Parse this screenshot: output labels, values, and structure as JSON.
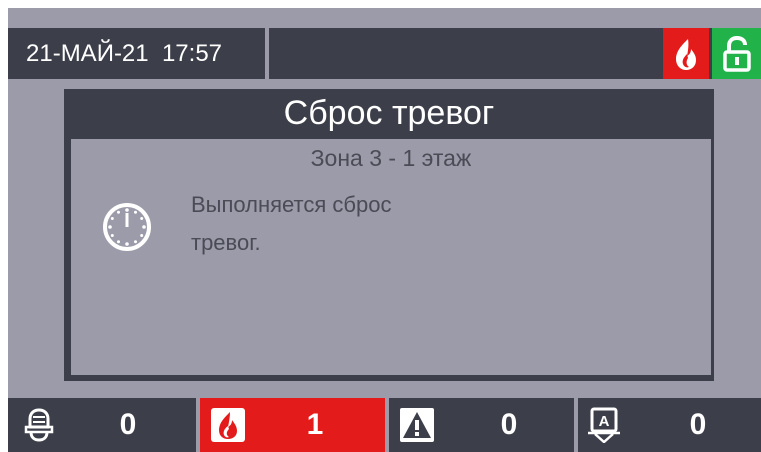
{
  "status_bar": {
    "datetime": "21-МАЙ-21  17:57",
    "icons": [
      "fire-icon",
      "unlocked-padlock-icon"
    ],
    "colors": {
      "fire": "#e41b1b",
      "unlocked": "#21b24a"
    }
  },
  "dialog": {
    "title": "Сброс тревог",
    "zone": "Зона 3 - 1 этаж",
    "message_line1": "Выполняется сброс",
    "message_line2": "тревог.",
    "icon": "clock-icon"
  },
  "counters": [
    {
      "icon": "siren-icon",
      "value": "0"
    },
    {
      "icon": "fire-icon",
      "value": "1",
      "active": true
    },
    {
      "icon": "warning-triangle-icon",
      "value": "0"
    },
    {
      "icon": "disabled-alarm-icon",
      "value": "0"
    }
  ],
  "colors": {
    "background": "#9b9baa",
    "panel": "#3c3f4a",
    "alarm": "#e41b1b"
  }
}
